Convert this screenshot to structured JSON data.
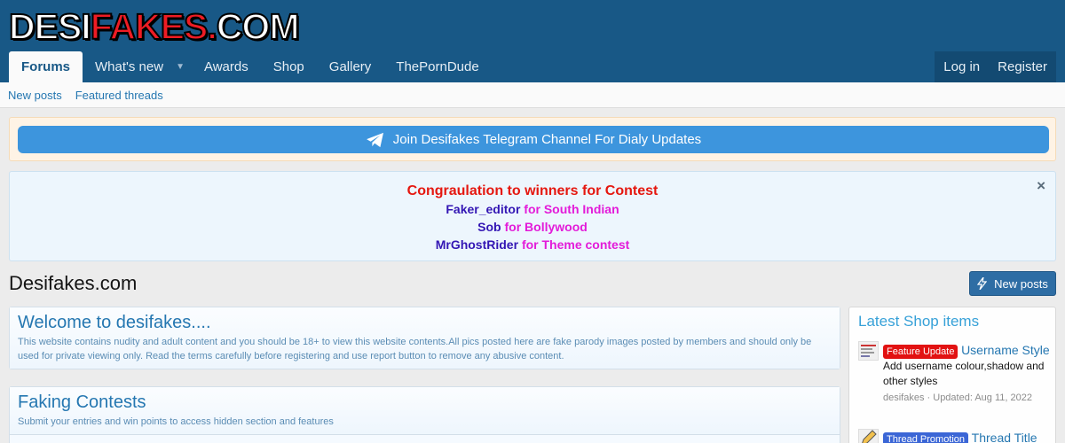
{
  "logo": {
    "part1": "DESI",
    "part2": "FAKES",
    "dot": ".",
    "part3": "COM"
  },
  "nav": {
    "items": [
      "Forums",
      "What's new",
      "Awards",
      "Shop",
      "Gallery",
      "ThePornDude"
    ],
    "login": "Log in",
    "register": "Register"
  },
  "subnav": [
    "New posts",
    "Featured threads"
  ],
  "telegram": {
    "label": "Join Desifakes Telegram Channel For Dialy Updates"
  },
  "notice": {
    "heading": "Congraulation to winners for Contest",
    "close": "×",
    "winners": [
      {
        "user": "Faker_editor",
        "for": "for South Indian"
      },
      {
        "user": "Sob",
        "for": "for Bollywood"
      },
      {
        "user": "MrGhostRider",
        "for": "for Theme contest"
      }
    ]
  },
  "page_title": "Desifakes.com",
  "new_posts_button": "New posts",
  "blocks": [
    {
      "title": "Welcome to desifakes....",
      "desc": "This website contains nudity and adult content and you should be 18+ to view this website contents.All pics posted here are fake parody images posted by members and should only be used for private viewing only. Read the terms carefully before registering and use report button to remove any abusive content."
    },
    {
      "title": "Faking Contests",
      "desc": "Submit your entries and win points to access hidden section and features"
    }
  ],
  "sidebar": {
    "title": "Latest Shop items",
    "items": [
      {
        "badge": "Feature Update",
        "badge_color": "#e21212",
        "title": "Username Style",
        "desc": "Add username colour,shadow and other styles",
        "meta": "desifakes · Updated: Aug 11, 2022"
      },
      {
        "badge": "Thread Promotion",
        "badge_color": "#3b66d6",
        "title": "Thread Title"
      }
    ]
  }
}
